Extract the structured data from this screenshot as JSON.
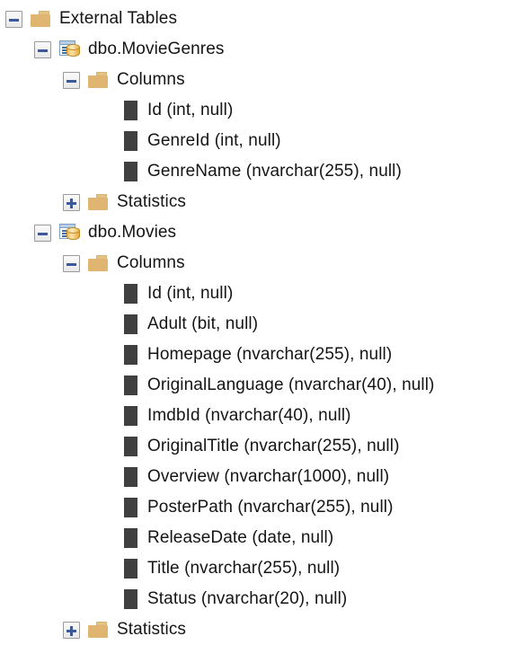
{
  "tree": {
    "name": "object-explorer-tree",
    "nodes": [
      {
        "label": "External Tables",
        "level": 1,
        "icon": "folder-icon",
        "expander": "minus"
      },
      {
        "label": "dbo.MovieGenres",
        "level": 2,
        "icon": "table-icon",
        "expander": "minus"
      },
      {
        "label": "Columns",
        "level": 3,
        "icon": "folder-icon",
        "expander": "minus"
      },
      {
        "label": "Id (int, null)",
        "level": 4,
        "icon": "column-icon",
        "expander": "none"
      },
      {
        "label": "GenreId (int, null)",
        "level": 4,
        "icon": "column-icon",
        "expander": "none"
      },
      {
        "label": "GenreName (nvarchar(255), null)",
        "level": 4,
        "icon": "column-icon",
        "expander": "none"
      },
      {
        "label": "Statistics",
        "level": 3,
        "icon": "folder-icon",
        "expander": "plus"
      },
      {
        "label": "dbo.Movies",
        "level": 2,
        "icon": "table-icon",
        "expander": "minus"
      },
      {
        "label": "Columns",
        "level": 3,
        "icon": "folder-icon",
        "expander": "minus"
      },
      {
        "label": "Id (int, null)",
        "level": 4,
        "icon": "column-icon",
        "expander": "none"
      },
      {
        "label": "Adult (bit, null)",
        "level": 4,
        "icon": "column-icon",
        "expander": "none"
      },
      {
        "label": "Homepage (nvarchar(255), null)",
        "level": 4,
        "icon": "column-icon",
        "expander": "none"
      },
      {
        "label": "OriginalLanguage (nvarchar(40), null)",
        "level": 4,
        "icon": "column-icon",
        "expander": "none"
      },
      {
        "label": "ImdbId (nvarchar(40), null)",
        "level": 4,
        "icon": "column-icon",
        "expander": "none"
      },
      {
        "label": "OriginalTitle (nvarchar(255), null)",
        "level": 4,
        "icon": "column-icon",
        "expander": "none"
      },
      {
        "label": "Overview (nvarchar(1000), null)",
        "level": 4,
        "icon": "column-icon",
        "expander": "none"
      },
      {
        "label": "PosterPath (nvarchar(255), null)",
        "level": 4,
        "icon": "column-icon",
        "expander": "none"
      },
      {
        "label": "ReleaseDate (date, null)",
        "level": 4,
        "icon": "column-icon",
        "expander": "none"
      },
      {
        "label": "Title (nvarchar(255), null)",
        "level": 4,
        "icon": "column-icon",
        "expander": "none"
      },
      {
        "label": "Status (nvarchar(20), null)",
        "level": 4,
        "icon": "column-icon",
        "expander": "none"
      },
      {
        "label": "Statistics",
        "level": 3,
        "icon": "folder-icon",
        "expander": "plus"
      }
    ]
  },
  "colors": {
    "background": "#ffffff",
    "text": "#151515",
    "folder": "#dfb571",
    "expander_glyph": "#3b5998",
    "expander_border": "#9a9a9a",
    "table_grid_line": "#3f6fa8",
    "cylinder": "#eab24a",
    "column_icon": "#404040"
  }
}
